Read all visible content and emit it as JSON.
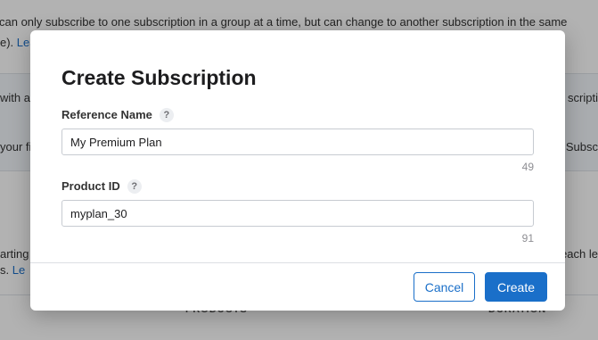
{
  "background": {
    "line1": "can only subscribe to one subscription in a group at a time, but can change to another subscription in the same",
    "line2_prefix": "e). ",
    "line2_link": "Lea",
    "band_left_top": "with a",
    "band_right_top": "scripti",
    "band_left_bottom": "your fi",
    "band_right_bottom": "Subsc",
    "lower_left_top": "arting",
    "lower_right_top": "each le",
    "lower_left_bottom_prefix": "s. ",
    "lower_left_bottom_link": "Le",
    "col_left": "PRODUCTS",
    "col_right": "DURATION"
  },
  "modal": {
    "title": "Create Subscription",
    "help_glyph": "?",
    "reference_name": {
      "label": "Reference Name",
      "value": "My Premium Plan",
      "remaining": "49"
    },
    "product_id": {
      "label": "Product ID",
      "value": "myplan_30",
      "remaining": "91"
    },
    "cancel_label": "Cancel",
    "create_label": "Create"
  },
  "colors": {
    "accent": "#1a6fc9",
    "overlay": "rgba(0,0,0,0.30)"
  }
}
